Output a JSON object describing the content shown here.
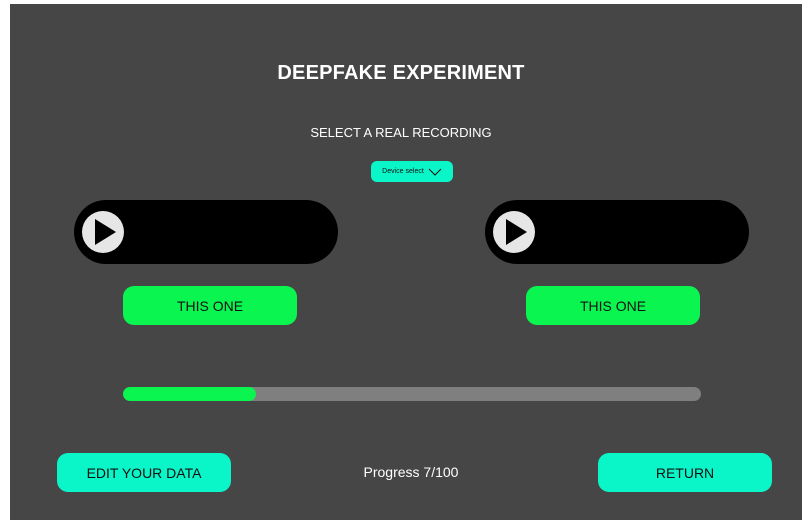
{
  "header": {
    "title": "DEEPFAKE EXPERIMENT",
    "subtitle": "SELECT A REAL RECORDING"
  },
  "device_select": {
    "label": "Device select",
    "icon": "chevron-down-icon"
  },
  "players": [
    {
      "icon": "play-icon",
      "choose_label": "THIS ONE"
    },
    {
      "icon": "play-icon",
      "choose_label": "THIS ONE"
    }
  ],
  "progress": {
    "current": 7,
    "total": 100,
    "label": "Progress 7/100",
    "fill_fraction": 0.23
  },
  "footer": {
    "edit_label": "EDIT YOUR DATA",
    "return_label": "RETURN"
  },
  "colors": {
    "background": "#464646",
    "accent_teal": "#0af5c8",
    "accent_green": "#0af550",
    "player_bg": "#000000",
    "track": "#7f7f7f"
  }
}
